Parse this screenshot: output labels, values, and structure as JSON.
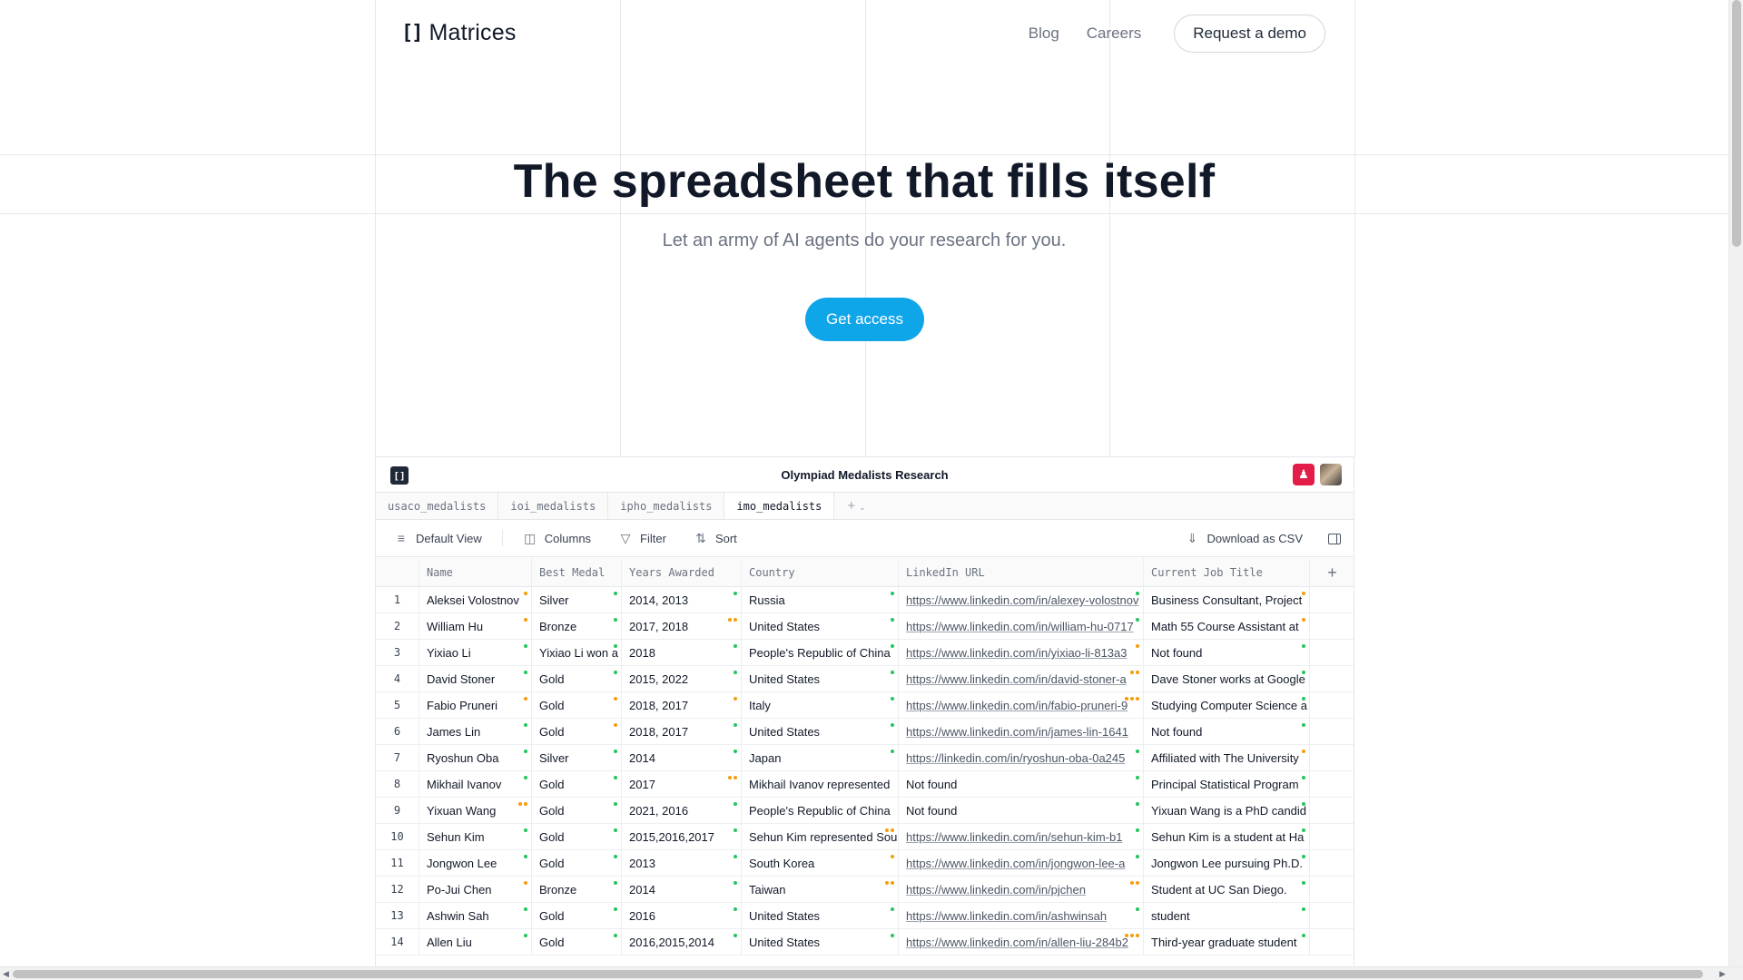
{
  "header": {
    "logo_mark": "[]",
    "logo_text": "Matrices",
    "nav": [
      "Blog",
      "Careers"
    ],
    "demo_label": "Request a demo"
  },
  "hero": {
    "title": "The spreadsheet that fills itself",
    "subtitle": "Let an army of AI agents do your research for you.",
    "cta": "Get access"
  },
  "app": {
    "logo_mark": "[]",
    "title": "Olympiad Medalists Research",
    "tabs": [
      "usaco_medalists",
      "ioi_medalists",
      "ipho_medalists",
      "imo_medalists"
    ],
    "active_tab": "imo_medalists",
    "add_tab": "+",
    "toolbar": {
      "view": "Default View",
      "columns": "Columns",
      "filter": "Filter",
      "sort": "Sort",
      "download": "Download as CSV"
    },
    "columns": [
      "Name",
      "Best Medal",
      "Years Awarded",
      "Country",
      "LinkedIn URL",
      "Current Job Title"
    ],
    "add_column": "+",
    "rows": [
      {
        "n": "1",
        "cells": [
          "Aleksei Volostnov",
          "Silver",
          "2014, 2013",
          "Russia",
          "https://www.linkedin.com/in/alexey-volostnov",
          "Business Consultant, Project"
        ]
      },
      {
        "n": "2",
        "cells": [
          "William Hu",
          "Bronze",
          "2017, 2018",
          "United States",
          "https://www.linkedin.com/in/william-hu-0717",
          "Math 55 Course Assistant at"
        ]
      },
      {
        "n": "3",
        "cells": [
          "Yixiao Li",
          "Yixiao Li won a",
          "2018",
          "People's Republic of China",
          "https://www.linkedin.com/in/yixiao-li-813a3",
          "Not found"
        ]
      },
      {
        "n": "4",
        "cells": [
          "David Stoner",
          "Gold",
          "2015, 2022",
          "United States",
          "https://www.linkedin.com/in/david-stoner-a",
          "Dave Stoner works at Google"
        ]
      },
      {
        "n": "5",
        "cells": [
          "Fabio Pruneri",
          "Gold",
          "2018, 2017",
          "Italy",
          "https://www.linkedin.com/in/fabio-pruneri-9",
          "Studying Computer Science a"
        ]
      },
      {
        "n": "6",
        "cells": [
          "James Lin",
          "Gold",
          "2018, 2017",
          "United States",
          "https://www.linkedin.com/in/james-lin-1641",
          "Not found"
        ]
      },
      {
        "n": "7",
        "cells": [
          "Ryoshun Oba",
          "Silver",
          "2014",
          "Japan",
          "https://linkedin.com/in/ryoshun-oba-0a245",
          "Affiliated with The University"
        ]
      },
      {
        "n": "8",
        "cells": [
          "Mikhail Ivanov",
          "Gold",
          "2017",
          "Mikhail Ivanov represented",
          "Not found",
          "Principal Statistical Program"
        ]
      },
      {
        "n": "9",
        "cells": [
          "Yixuan Wang",
          "Gold",
          "2021, 2016",
          "People's Republic of China",
          "Not found",
          "Yixuan Wang is a PhD candid"
        ]
      },
      {
        "n": "10",
        "cells": [
          "Sehun Kim",
          "Gold",
          "2015,2016,2017",
          "Sehun Kim represented Sou",
          "https://www.linkedin.com/in/sehun-kim-b1",
          "Sehun Kim is a student at Ha"
        ]
      },
      {
        "n": "11",
        "cells": [
          "Jongwon Lee",
          "Gold",
          "2013",
          "South Korea",
          "https://www.linkedin.com/in/jongwon-lee-a",
          "Jongwon Lee pursuing Ph.D."
        ]
      },
      {
        "n": "12",
        "cells": [
          "Po-Jui Chen",
          "Bronze",
          "2014",
          "Taiwan",
          "https://www.linkedin.com/in/pjchen",
          "Student at UC San Diego."
        ]
      },
      {
        "n": "13",
        "cells": [
          "Ashwin Sah",
          "Gold",
          "2016",
          "United States",
          "https://www.linkedin.com/in/ashwinsah",
          "student"
        ]
      },
      {
        "n": "14",
        "cells": [
          "Allen Liu",
          "Gold",
          "2016,2015,2014",
          "United States",
          "https://www.linkedin.com/in/allen-liu-284b2",
          "Third-year graduate student"
        ]
      }
    ],
    "status_colors": {
      "done": "#22c55e",
      "pending": "#f59e0b"
    }
  },
  "colors": {
    "accent": "#0ea5e9",
    "text": "#111827",
    "muted": "#6b7280"
  }
}
